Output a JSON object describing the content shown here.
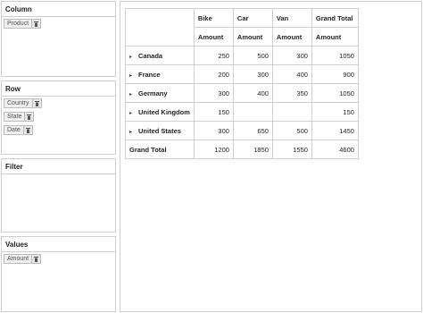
{
  "panels": {
    "column": {
      "title": "Column",
      "fields": [
        "Product"
      ]
    },
    "row": {
      "title": "Row",
      "fields": [
        "Country",
        "State",
        "Date"
      ]
    },
    "filter": {
      "title": "Filter",
      "fields": []
    },
    "values": {
      "title": "Values",
      "fields": [
        "Amount"
      ]
    }
  },
  "grid": {
    "columns": [
      "Bike",
      "Car",
      "Van",
      "Grand Total"
    ],
    "measure": "Amount",
    "rows": [
      {
        "label": "Canada",
        "expandable": true,
        "values": [
          "250",
          "500",
          "300",
          "1050"
        ]
      },
      {
        "label": "France",
        "expandable": true,
        "values": [
          "200",
          "300",
          "400",
          "900"
        ]
      },
      {
        "label": "Germany",
        "expandable": true,
        "values": [
          "300",
          "400",
          "350",
          "1050"
        ]
      },
      {
        "label": "United Kingdom",
        "expandable": true,
        "values": [
          "150",
          "",
          "",
          "150"
        ]
      },
      {
        "label": "United States",
        "expandable": true,
        "values": [
          "300",
          "650",
          "500",
          "1450"
        ]
      }
    ],
    "grand_total": {
      "label": "Grand Total",
      "values": [
        "1200",
        "1850",
        "1550",
        "4600"
      ]
    }
  },
  "icons": {
    "remove": "trash-icon",
    "expand": "caret-right-icon"
  }
}
